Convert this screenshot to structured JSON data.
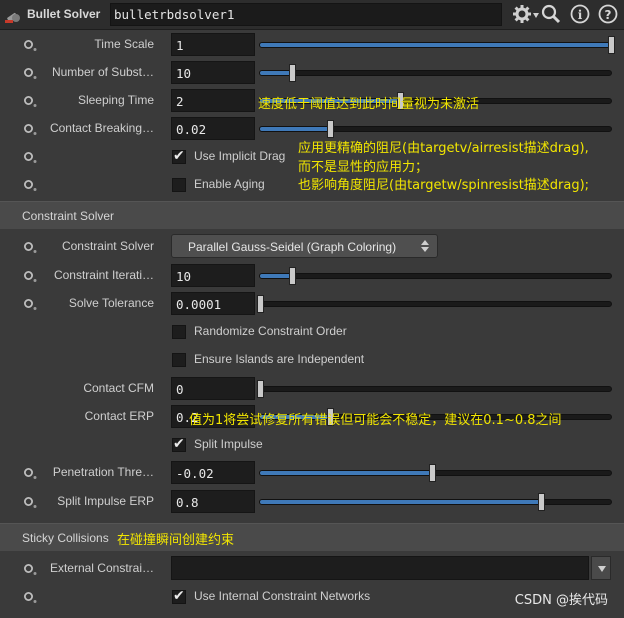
{
  "header": {
    "node_type": "Bullet Solver",
    "node_name": "bulletrbdsolver1",
    "icons": [
      "gear-icon",
      "search-icon",
      "info-icon",
      "help-icon"
    ]
  },
  "params": {
    "time_scale": {
      "label": "Time Scale",
      "value": "1",
      "fraction": 1.0
    },
    "num_substeps": {
      "label": "Number of Subst…",
      "value": "10",
      "fraction": 0.09
    },
    "sleeping_time": {
      "label": "Sleeping Time",
      "value": "2",
      "fraction": 0.4
    },
    "contact_breaking": {
      "label": "Contact Breaking…",
      "value": "0.02",
      "fraction": 0.2
    },
    "implicit_drag": {
      "label": "Use Implicit Drag",
      "checked": true
    },
    "aging": {
      "label": "Enable Aging",
      "checked": false
    }
  },
  "constraint_section": {
    "title": "Constraint Solver",
    "solver": {
      "label": "Constraint Solver",
      "value": "Parallel Gauss-Seidel (Graph Coloring)"
    },
    "iterations": {
      "label": "Constraint Iterati…",
      "value": "10",
      "fraction": 0.09
    },
    "tolerance": {
      "label": "Solve Tolerance",
      "value": "0.0001",
      "fraction": 0.0
    },
    "randomize": {
      "label": "Randomize Constraint Order",
      "checked": false
    },
    "islands": {
      "label": "Ensure Islands are Independent",
      "checked": false
    },
    "cfm": {
      "label": "Contact CFM",
      "value": "0",
      "fraction": 0.0
    },
    "erp": {
      "label": "Contact ERP",
      "value": "0.2",
      "fraction": 0.2
    },
    "split_impulse": {
      "label": "Split Impulse",
      "checked": true
    },
    "penetration": {
      "label": "Penetration Thre…",
      "value": "-0.02",
      "fraction": 0.49
    },
    "split_erp": {
      "label": "Split Impulse ERP",
      "value": "0.8",
      "fraction": 0.8
    }
  },
  "sticky_section": {
    "title": "Sticky Collisions",
    "external": {
      "label": "External Constrai…",
      "value": ""
    },
    "internal": {
      "label": "Use Internal Constraint Networks",
      "checked": true
    }
  },
  "annotations": {
    "sleeping": "速度低于阈值达到此时间量视为未激活",
    "drag_line1": "应用更精确的阻尼(由targetv/airresist描述drag),",
    "drag_line2": "而不是显性的应用力；",
    "drag_line3": "也影响角度阻尼(由targetw/spinresist描述drag);",
    "erp": "值为1将尝试修复所有错误但可能会不稳定，建议在0.1~0.8之间",
    "sticky": "在碰撞瞬间创建约束"
  },
  "watermark": "CSDN @挨代码",
  "colors": {
    "accent": "#3f79b8",
    "annotation": "#f2e600"
  }
}
